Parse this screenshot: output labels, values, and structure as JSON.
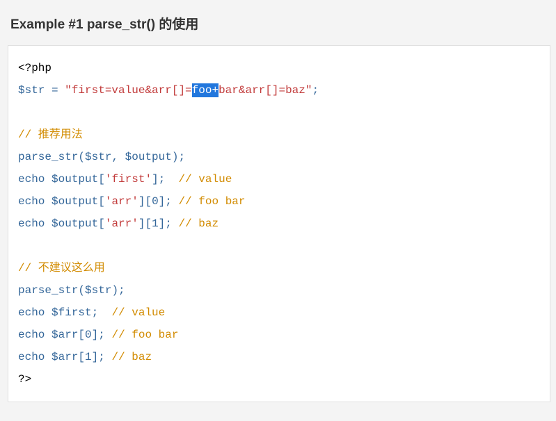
{
  "header": {
    "title": "Example #1 parse_str() 的使用"
  },
  "code": {
    "openTag": "<?php",
    "line2_var": "$str",
    "line2_eq": " = ",
    "line2_str_a": "\"first=value&arr[]=",
    "line2_selected": "foo+",
    "line2_str_b": "bar&arr[]=baz\"",
    "line2_semi": ";",
    "comment_recommended": "// 推荐用法",
    "parse1_fn": "parse_str",
    "parse1_open": "(",
    "parse1_arg1": "$str",
    "parse1_comma": ", ",
    "parse1_arg2": "$output",
    "parse1_close": ")",
    "parse1_semi": ";",
    "echo1_kw": "echo ",
    "echo1_var": "$output",
    "echo1_b1": "[",
    "echo1_key": "'first'",
    "echo1_b2": "]",
    "echo1_semi": ";",
    "echo1_comment": "  // value",
    "echo2_kw": "echo ",
    "echo2_var": "$output",
    "echo2_b1": "[",
    "echo2_key": "'arr'",
    "echo2_b2": "][",
    "echo2_idx": "0",
    "echo2_b3": "]",
    "echo2_semi": ";",
    "echo2_comment": " // foo bar",
    "echo3_kw": "echo ",
    "echo3_var": "$output",
    "echo3_b1": "[",
    "echo3_key": "'arr'",
    "echo3_b2": "][",
    "echo3_idx": "1",
    "echo3_b3": "]",
    "echo3_semi": ";",
    "echo3_comment": " // baz",
    "comment_notrecommended": "// 不建议这么用",
    "parse2_fn": "parse_str",
    "parse2_open": "(",
    "parse2_arg1": "$str",
    "parse2_close": ")",
    "parse2_semi": ";",
    "echo4_kw": "echo ",
    "echo4_var": "$first",
    "echo4_semi": ";",
    "echo4_comment": "  // value",
    "echo5_kw": "echo ",
    "echo5_var": "$arr",
    "echo5_b1": "[",
    "echo5_idx": "0",
    "echo5_b2": "]",
    "echo5_semi": ";",
    "echo5_comment": " // foo bar",
    "echo6_kw": "echo ",
    "echo6_var": "$arr",
    "echo6_b1": "[",
    "echo6_idx": "1",
    "echo6_b2": "]",
    "echo6_semi": ";",
    "echo6_comment": " // baz",
    "closeTag": "?>"
  }
}
